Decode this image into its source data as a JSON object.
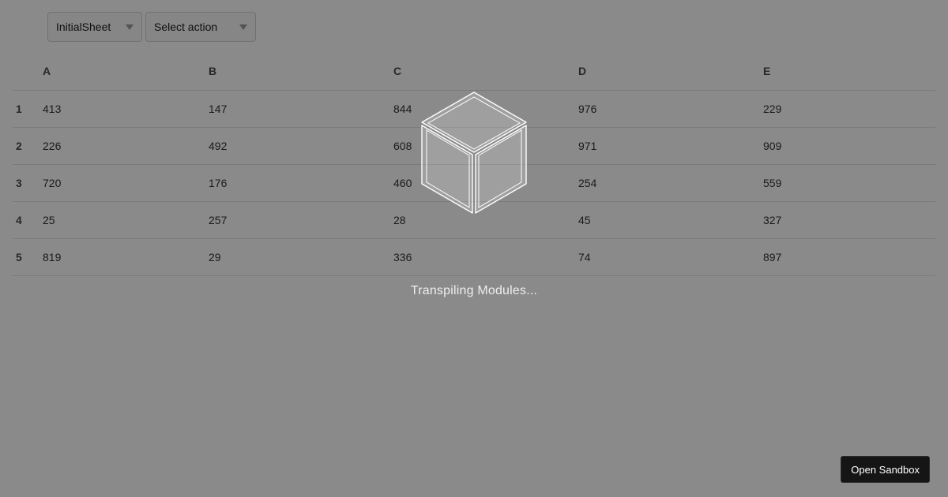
{
  "toolbar": {
    "sheet_select": "InitialSheet",
    "action_select": "Select action"
  },
  "table": {
    "columns": [
      "A",
      "B",
      "C",
      "D",
      "E"
    ],
    "rows": [
      {
        "label": "1",
        "cells": [
          "413",
          "147",
          "844",
          "976",
          "229"
        ]
      },
      {
        "label": "2",
        "cells": [
          "226",
          "492",
          "608",
          "971",
          "909"
        ]
      },
      {
        "label": "3",
        "cells": [
          "720",
          "176",
          "460",
          "254",
          "559"
        ]
      },
      {
        "label": "4",
        "cells": [
          "25",
          "257",
          "28",
          "45",
          "327"
        ]
      },
      {
        "label": "5",
        "cells": [
          "819",
          "29",
          "336",
          "74",
          "897"
        ]
      }
    ]
  },
  "overlay": {
    "loading_text": "Transpiling Modules...",
    "loader_icon": "cube-loader-icon"
  },
  "open_sandbox_label": "Open Sandbox",
  "colors": {
    "overlay": "#7a7a7a",
    "button_bg": "#151515"
  }
}
